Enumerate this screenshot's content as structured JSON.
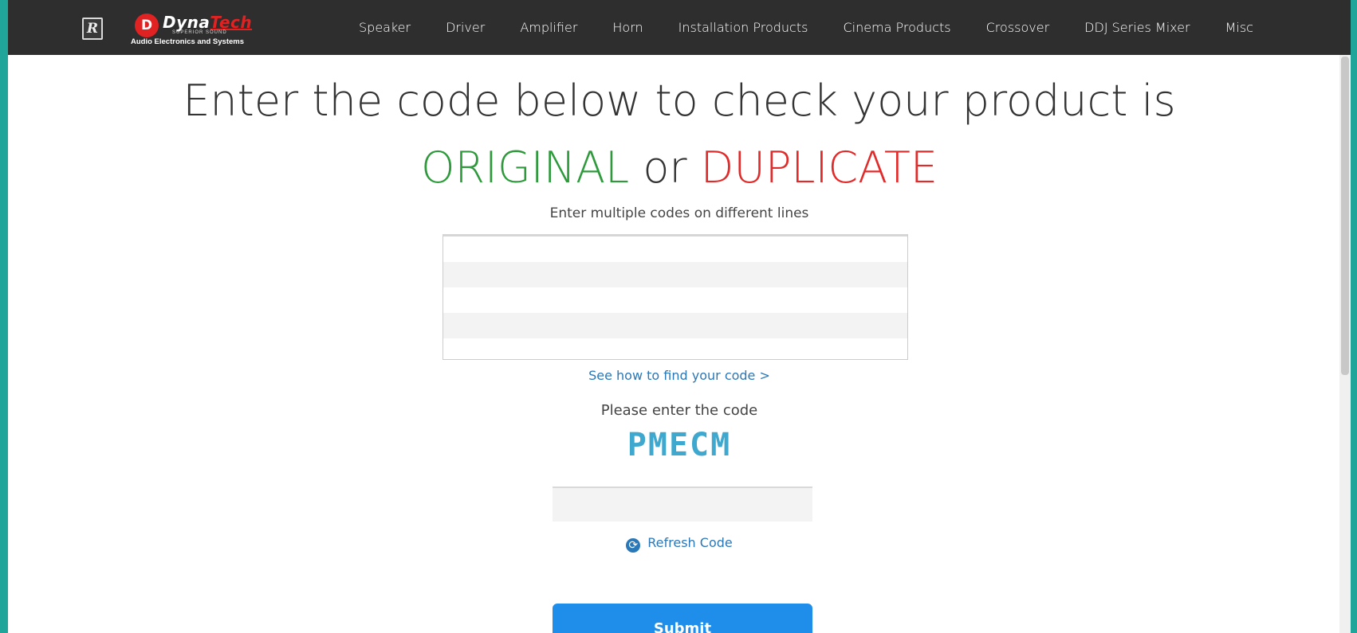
{
  "brand": {
    "badge_letter": "R",
    "disc_letter": "D",
    "name_part1": "Dyna",
    "name_part2": "Tech",
    "tagline": "SUPERIOR SOUND",
    "subtitle": "Audio Electronics and Systems"
  },
  "nav": {
    "items": [
      "Speaker",
      "Driver",
      "Amplifier",
      "Horn",
      "Installation Products",
      "Cinema Products",
      "Crossover",
      "DDJ Series Mixer",
      "Misc"
    ]
  },
  "main": {
    "heading_line1": "Enter the code below to check your product is",
    "original_word": "ORIGINAL",
    "or_word": "or",
    "duplicate_word": "DUPLICATE",
    "hint": "Enter multiple codes on different lines",
    "codes_value": "",
    "find_code_link": "See how to find your code >",
    "captcha_prompt": "Please enter the code",
    "captcha_text": "PMECM",
    "captcha_input_value": "",
    "refresh_label": "Refresh Code",
    "submit_label": "Submit"
  },
  "colors": {
    "topbar": "#2e2e2e",
    "frame_border": "#21a49a",
    "original": "#2e9a3c",
    "duplicate": "#e12b2b",
    "link": "#2a78b8",
    "captcha": "#3fa8cf",
    "submit": "#1e8eea"
  },
  "icons": {
    "refresh": "refresh-icon",
    "logo": "r-badge-logo"
  }
}
